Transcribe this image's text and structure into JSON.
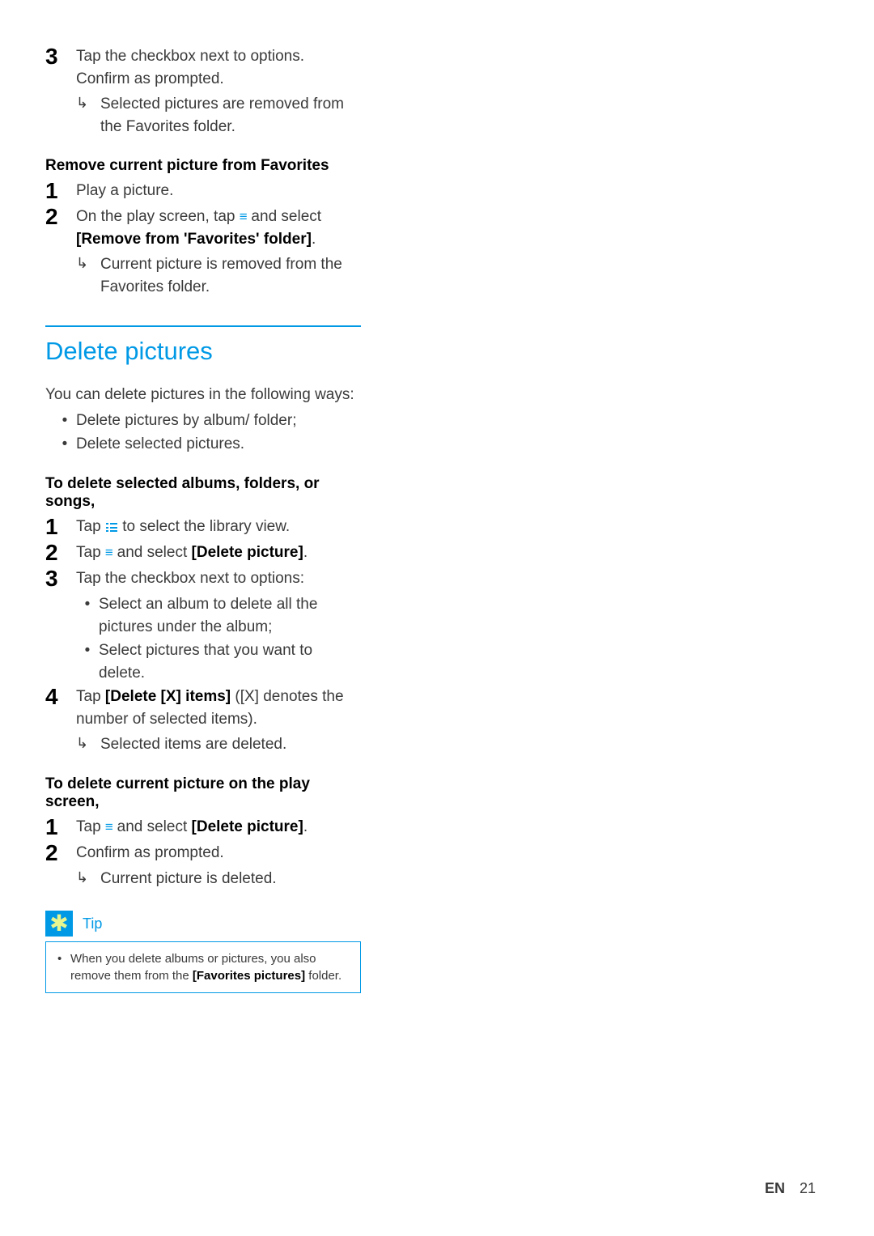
{
  "topContinuation": {
    "step3": {
      "num": "3",
      "line1": "Tap the checkbox next to options. Confirm as prompted.",
      "result": "Selected pictures are removed from the Favorites folder."
    }
  },
  "removeCurrent": {
    "heading": "Remove current picture from Favorites",
    "step1": {
      "num": "1",
      "text": "Play a picture."
    },
    "step2": {
      "num": "2",
      "before": "On the play screen, tap ",
      "after": " and select ",
      "bold": "[Remove from 'Favorites' folder]",
      "tail": ".",
      "result": "Current picture is removed from the Favorites folder."
    }
  },
  "deleteSection": {
    "title": "Delete pictures",
    "intro": "You can delete pictures in the following ways:",
    "bullets": [
      "Delete pictures by album/ folder;",
      "Delete selected pictures."
    ]
  },
  "deleteSelected": {
    "heading": "To delete selected albums, folders, or songs,",
    "step1": {
      "num": "1",
      "before": "Tap ",
      "after": " to select the library view."
    },
    "step2": {
      "num": "2",
      "before": "Tap ",
      "after": " and select ",
      "bold": "[Delete picture]",
      "tail": "."
    },
    "step3": {
      "num": "3",
      "text": "Tap the checkbox next to options:",
      "sub1": "Select an album to delete all the pictures under the album;",
      "sub2": "Select pictures that you want to delete."
    },
    "step4": {
      "num": "4",
      "before": "Tap ",
      "bold": "[Delete [X] items]",
      "after": " ([X] denotes the number of selected items).",
      "result": "Selected items are deleted."
    }
  },
  "deleteCurrent": {
    "heading": "To delete current picture on the play screen,",
    "step1": {
      "num": "1",
      "before": "Tap ",
      "after": " and select ",
      "bold": "[Delete picture]",
      "tail": "."
    },
    "step2": {
      "num": "2",
      "text": "Confirm as prompted.",
      "result": "Current picture is deleted."
    }
  },
  "tip": {
    "label": "Tip",
    "text_before": "When you delete albums or pictures, you also remove them from the ",
    "bold": "[Favorites pictures]",
    "text_after": " folder."
  },
  "footer": {
    "lang": "EN",
    "page": "21"
  }
}
